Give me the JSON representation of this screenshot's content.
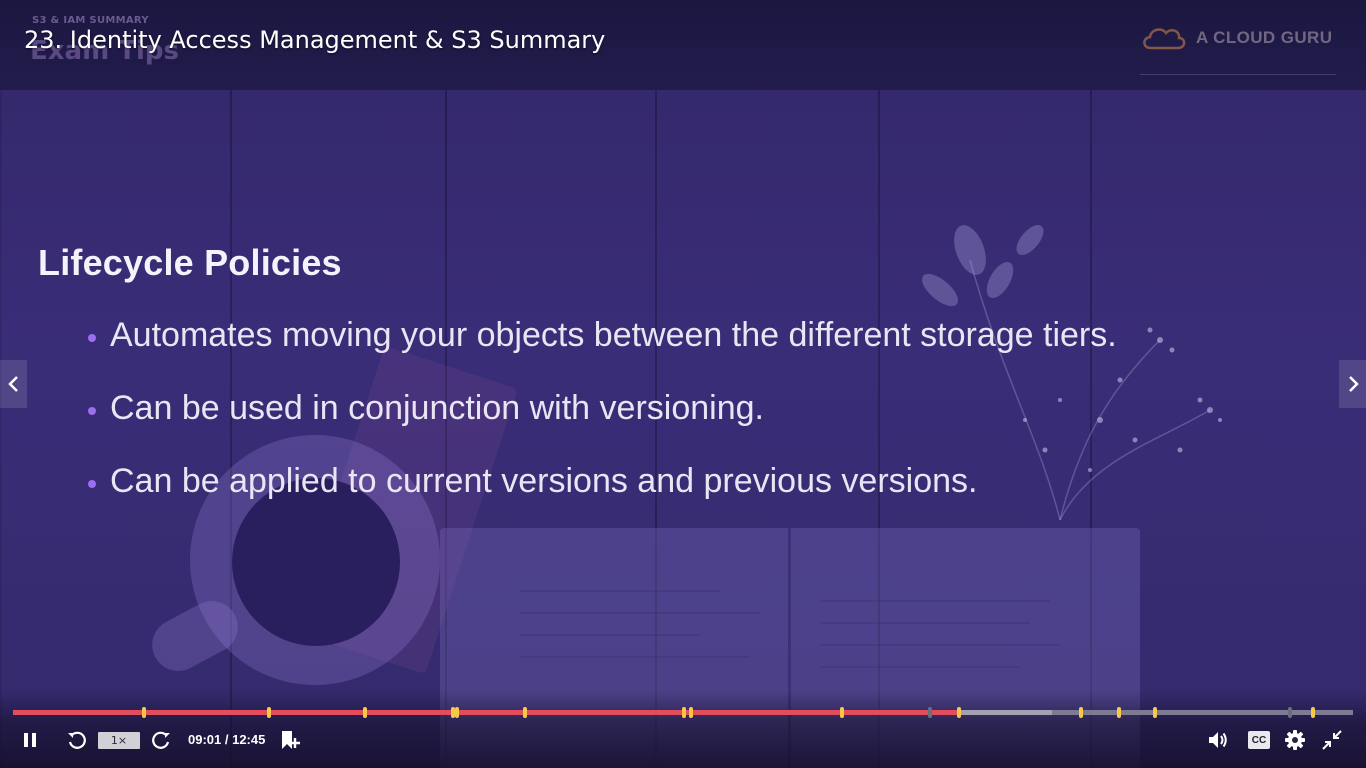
{
  "player": {
    "lesson_title": "23. Identity Access Management & S3 Summary",
    "time_current": "09:01",
    "time_separator": " / ",
    "time_total": "12:45",
    "speed_label": "1×",
    "cc_label": "CC",
    "progress_fraction": 0.7067,
    "buffered_fraction": 0.7755,
    "bookmark_markers": [
      0.098,
      0.191,
      0.263,
      0.328,
      0.331,
      0.382,
      0.501,
      0.506,
      0.619,
      0.706,
      0.797,
      0.825,
      0.852,
      0.97
    ],
    "section_markers": [
      0.382,
      0.501,
      0.684,
      0.953
    ],
    "icons": [
      "pause-icon",
      "rewind-5-icon",
      "forward-5-icon",
      "add-note-icon",
      "volume-icon",
      "settings-icon",
      "exit-fullscreen-icon",
      "chevron-left-icon",
      "chevron-right-icon"
    ]
  },
  "slide": {
    "kicker": "S3 & IAM SUMMARY",
    "heading": "Exam Tips",
    "brand": "A CLOUD GURU",
    "title": "Lifecycle Policies",
    "bullets": [
      "Automates moving your objects between the different storage tiers.",
      "Can be used in conjunction with versioning.",
      "Can be applied to current versions and previous versions."
    ]
  },
  "colors": {
    "played": "#e34c5a",
    "marker": "#f7c948",
    "bullet": "#9b6ff0",
    "background": "#2a2258"
  }
}
